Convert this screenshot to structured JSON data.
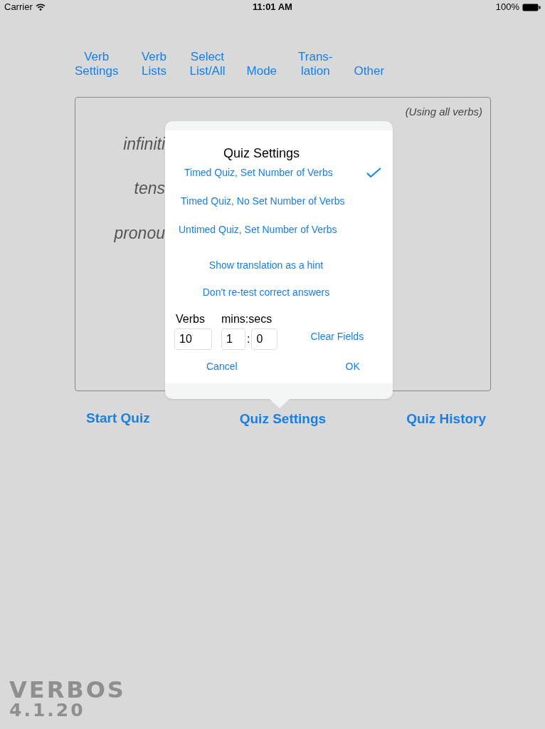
{
  "status_bar": {
    "carrier": "Carrier",
    "time": "11:01 AM",
    "battery": "100%"
  },
  "toolbar": [
    {
      "line1": "Verb",
      "line2": "Settings"
    },
    {
      "line1": "Verb",
      "line2": "Lists"
    },
    {
      "line1": "Select",
      "line2": "List/All"
    },
    {
      "line2": "Mode"
    },
    {
      "line1": "Trans-",
      "line2": "lation"
    },
    {
      "line2": "Other"
    }
  ],
  "quiz_panel": {
    "note": "(Using all verbs)",
    "labels": [
      "infiniti",
      "tens",
      "pronou"
    ]
  },
  "popover": {
    "title": "Quiz Settings",
    "modes": [
      {
        "label": "Timed Quiz, Set Number of Verbs",
        "selected": true
      },
      {
        "label": "Timed Quiz, No Set Number of Verbs",
        "selected": false
      },
      {
        "label": "Untimed Quiz, Set Number of Verbs",
        "selected": false
      }
    ],
    "toggles": [
      "Show translation as a hint",
      "Don't re-test correct answers"
    ],
    "verbs_label": "Verbs",
    "time_label": "mins:secs",
    "verbs_value": "10",
    "mins_value": "1",
    "separator": ":",
    "secs_value": "0",
    "clear": "Clear Fields",
    "cancel": "Cancel",
    "ok": "OK"
  },
  "bottom_buttons": [
    "Start Quiz",
    "Quiz Settings",
    "Quiz History"
  ],
  "logo": {
    "name": "VERBOS",
    "version": "4.1.20"
  }
}
